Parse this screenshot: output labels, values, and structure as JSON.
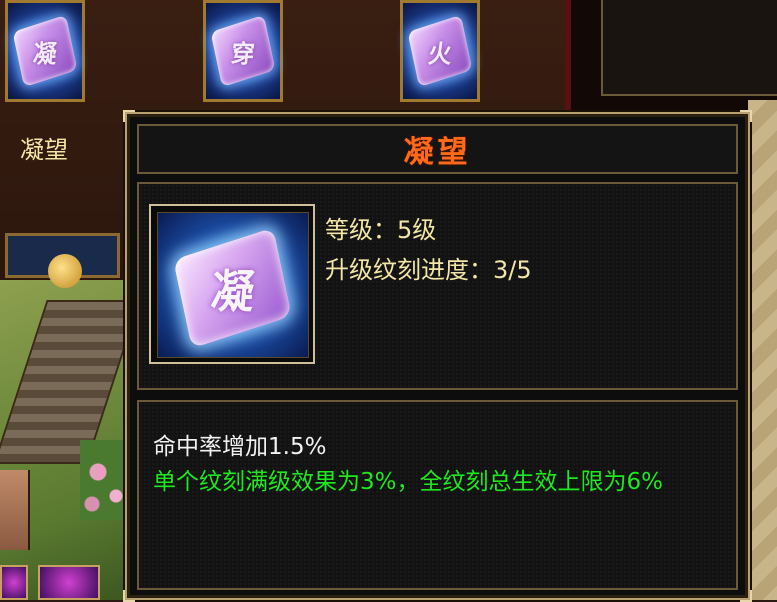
{
  "skill_slots": [
    {
      "glyph": "凝"
    },
    {
      "glyph": "穿"
    },
    {
      "glyph": "火"
    }
  ],
  "slot_caption": "凝望",
  "tooltip": {
    "title": "凝望",
    "icon_glyph": "凝",
    "level": "等级：5级",
    "upgrade_progress": "升级纹刻进度：3/5",
    "effect": "命中率增加1.5%",
    "note": "单个纹刻满级效果为3%，全纹刻总生效上限为6%"
  },
  "colors": {
    "title": "#ff6a1a",
    "stat_text": "#f3e6a6",
    "effect_text": "#f2f2f2",
    "note_text": "#1ee81e",
    "frame": "#b8a070"
  }
}
